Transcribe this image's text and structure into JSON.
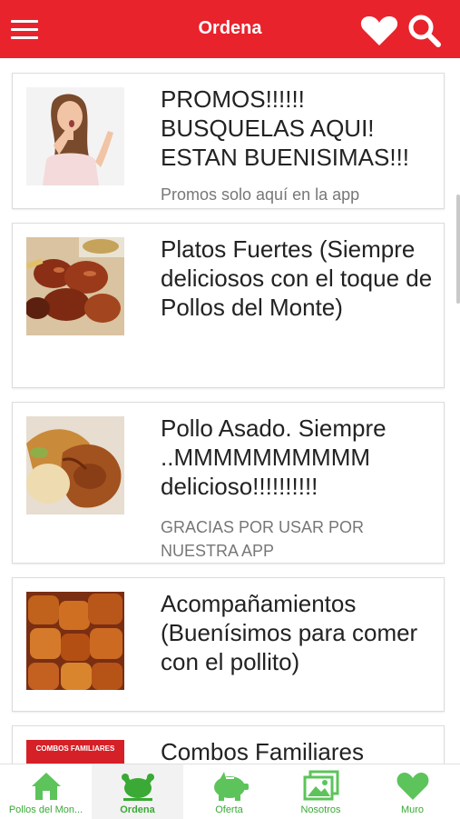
{
  "header": {
    "title": "Ordena",
    "menu_icon": "hamburger-menu-icon",
    "favorite_icon": "heart-icon",
    "search_icon": "search-icon",
    "color": "#e8232c"
  },
  "cards": [
    {
      "title": "PROMOS!!!!!! BUSQUELAS AQUI! ESTAN BUENISIMAS!!!",
      "subtitle": "Promos solo aquí en la app",
      "image": "woman-surprised-photo"
    },
    {
      "title": "Platos Fuertes (Siempre deliciosos con el toque de Pollos del Monte)",
      "subtitle": "",
      "image": "chicken-wings-photo"
    },
    {
      "title": "Pollo Asado. Siempre ..MMMMMMMMMM delicioso!!!!!!!!!!",
      "subtitle": "GRACIAS POR USAR POR NUESTRA APP",
      "image": "roast-chicken-photo"
    },
    {
      "title": "Acompañamientos (Buenísimos para comer con el pollito)",
      "subtitle": "",
      "image": "fried-croquettes-photo"
    },
    {
      "title": "Combos Familiares",
      "subtitle": "",
      "image": "combos-familiares-banner",
      "banner_text": "COMBOS FAMILIARES"
    }
  ],
  "bottom_nav": [
    {
      "label": "Pollos del Mon...",
      "icon": "home-icon",
      "active": false
    },
    {
      "label": "Ordena",
      "icon": "chicken-icon",
      "active": true
    },
    {
      "label": "Oferta",
      "icon": "piggy-bank-icon",
      "active": false
    },
    {
      "label": "Nosotros",
      "icon": "gallery-icon",
      "active": false
    },
    {
      "label": "Muro",
      "icon": "heart-icon",
      "active": false
    }
  ],
  "nav_color": "#3aa935"
}
